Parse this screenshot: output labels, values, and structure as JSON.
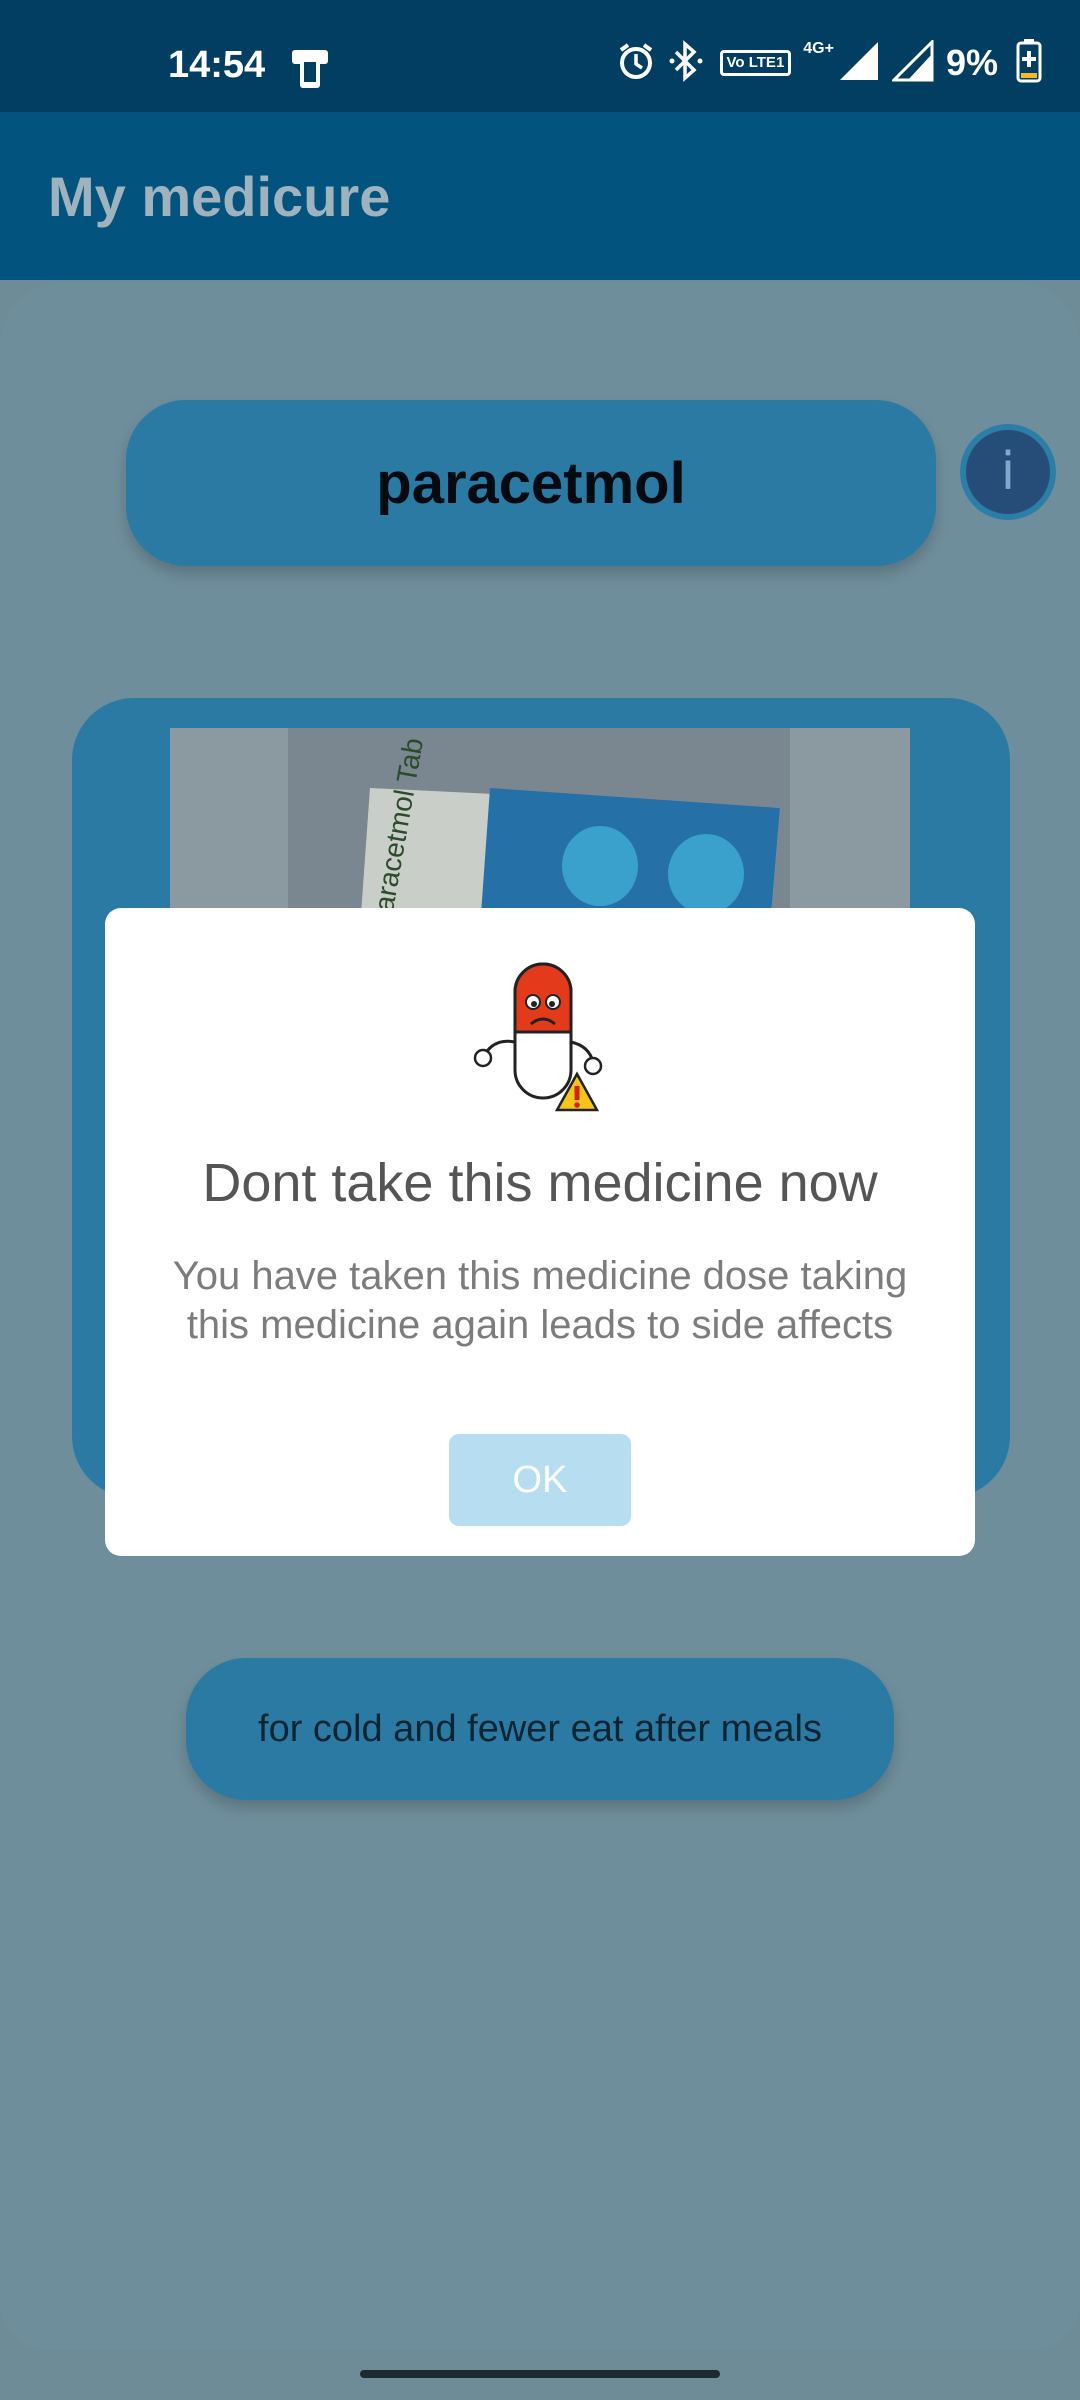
{
  "status_bar": {
    "time": "14:54",
    "lte_label": "Vo LTE1",
    "network": "4G+",
    "battery": "9%"
  },
  "app_bar": {
    "title": "My medicure"
  },
  "medicine": {
    "name": "paracetmol",
    "info_icon": "i",
    "photo_label": "paracetmol Tab"
  },
  "description": "for cold and fewer eat after meals",
  "dialog": {
    "title": "Dont take this medicine now",
    "message": "You have taken this medicine dose taking this medicine again leads to side affects",
    "ok_label": "OK",
    "illustration": "sad-pill-warning"
  },
  "colors": {
    "status_bar": "#023e62",
    "app_bar": "#03537f",
    "pill": "#2a7aa3",
    "ok_button": "#b6def0"
  }
}
